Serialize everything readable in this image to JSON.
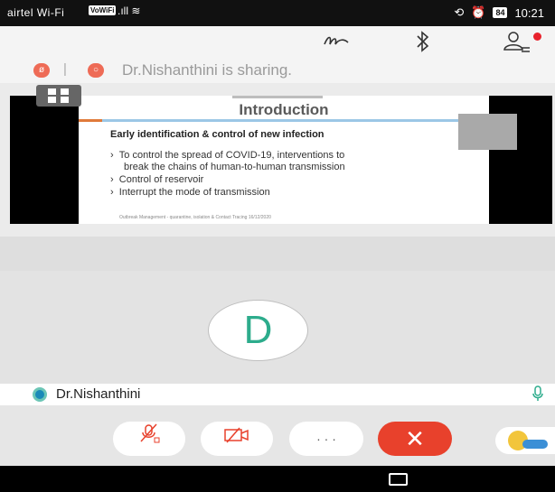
{
  "status_bar": {
    "carrier": "airtel Wi-Fi",
    "volte_badge": "VoWiFi",
    "battery": "84",
    "time": "10:21"
  },
  "top_bar": {
    "icons": [
      "pen-scribble-icon",
      "bluetooth-icon",
      "participants-icon"
    ],
    "notification_color": "#e8222c"
  },
  "share_bar": {
    "sharing_text": "Dr.Nishanthini is sharing."
  },
  "slide": {
    "title": "Introduction",
    "heading": "Early identification & control of new infection",
    "bullets": [
      "To control the spread of COVID-19, interventions to",
      "break the chains of human-to-human transmission",
      "Control of reservoir",
      "Interrupt the mode of transmission"
    ],
    "footer": "Outbreak Management - quarantine, isolation & Contact Tracing     16/12/2020"
  },
  "participant": {
    "avatar_letter": "D",
    "name": "Dr.Nishanthini",
    "accent_color": "#2dac8c"
  },
  "controls": {
    "icons": [
      "mic-muted-icon",
      "video-off-icon",
      "more-icon",
      "end-call-icon",
      "reaction-icon"
    ],
    "more_label": "· · ·",
    "end_label": "✕",
    "end_color": "#e8412c"
  }
}
